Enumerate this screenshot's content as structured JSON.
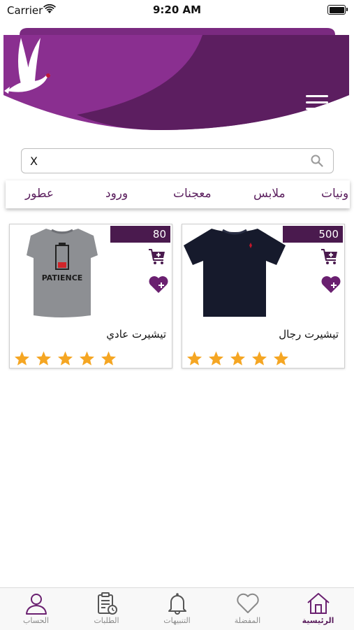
{
  "status_bar": {
    "carrier": "Carrier",
    "time": "9:20 AM"
  },
  "colors": {
    "brand": "#6a2070",
    "brand_dark": "#4a1a4e",
    "star": "#f5a623"
  },
  "header": {
    "menu_icon": "hamburger-menu-icon",
    "logo_icon": "dove-logo-icon"
  },
  "search": {
    "value": "X",
    "icon": "search-icon"
  },
  "categories": [
    "ونيات",
    "ملابس",
    "معجنات",
    "ورود",
    "عطور"
  ],
  "products": [
    {
      "name": "تيشيرت رجال",
      "price": "500",
      "rating": 5,
      "image": "navy-tshirt"
    },
    {
      "name": "تيشيرت عادي",
      "price": "80",
      "rating": 5,
      "image": "grey-patience-tshirt"
    }
  ],
  "tshirt_print": "PATIENCE",
  "tabs": [
    {
      "label": "الرئيسية",
      "icon": "home-icon",
      "active": true
    },
    {
      "label": "المفضلة",
      "icon": "heart-icon",
      "active": false
    },
    {
      "label": "التنبيهات",
      "icon": "bell-icon",
      "active": false
    },
    {
      "label": "الطلبات",
      "icon": "orders-clipboard-icon",
      "active": false
    },
    {
      "label": "الحساب",
      "icon": "user-icon",
      "active": false
    }
  ]
}
